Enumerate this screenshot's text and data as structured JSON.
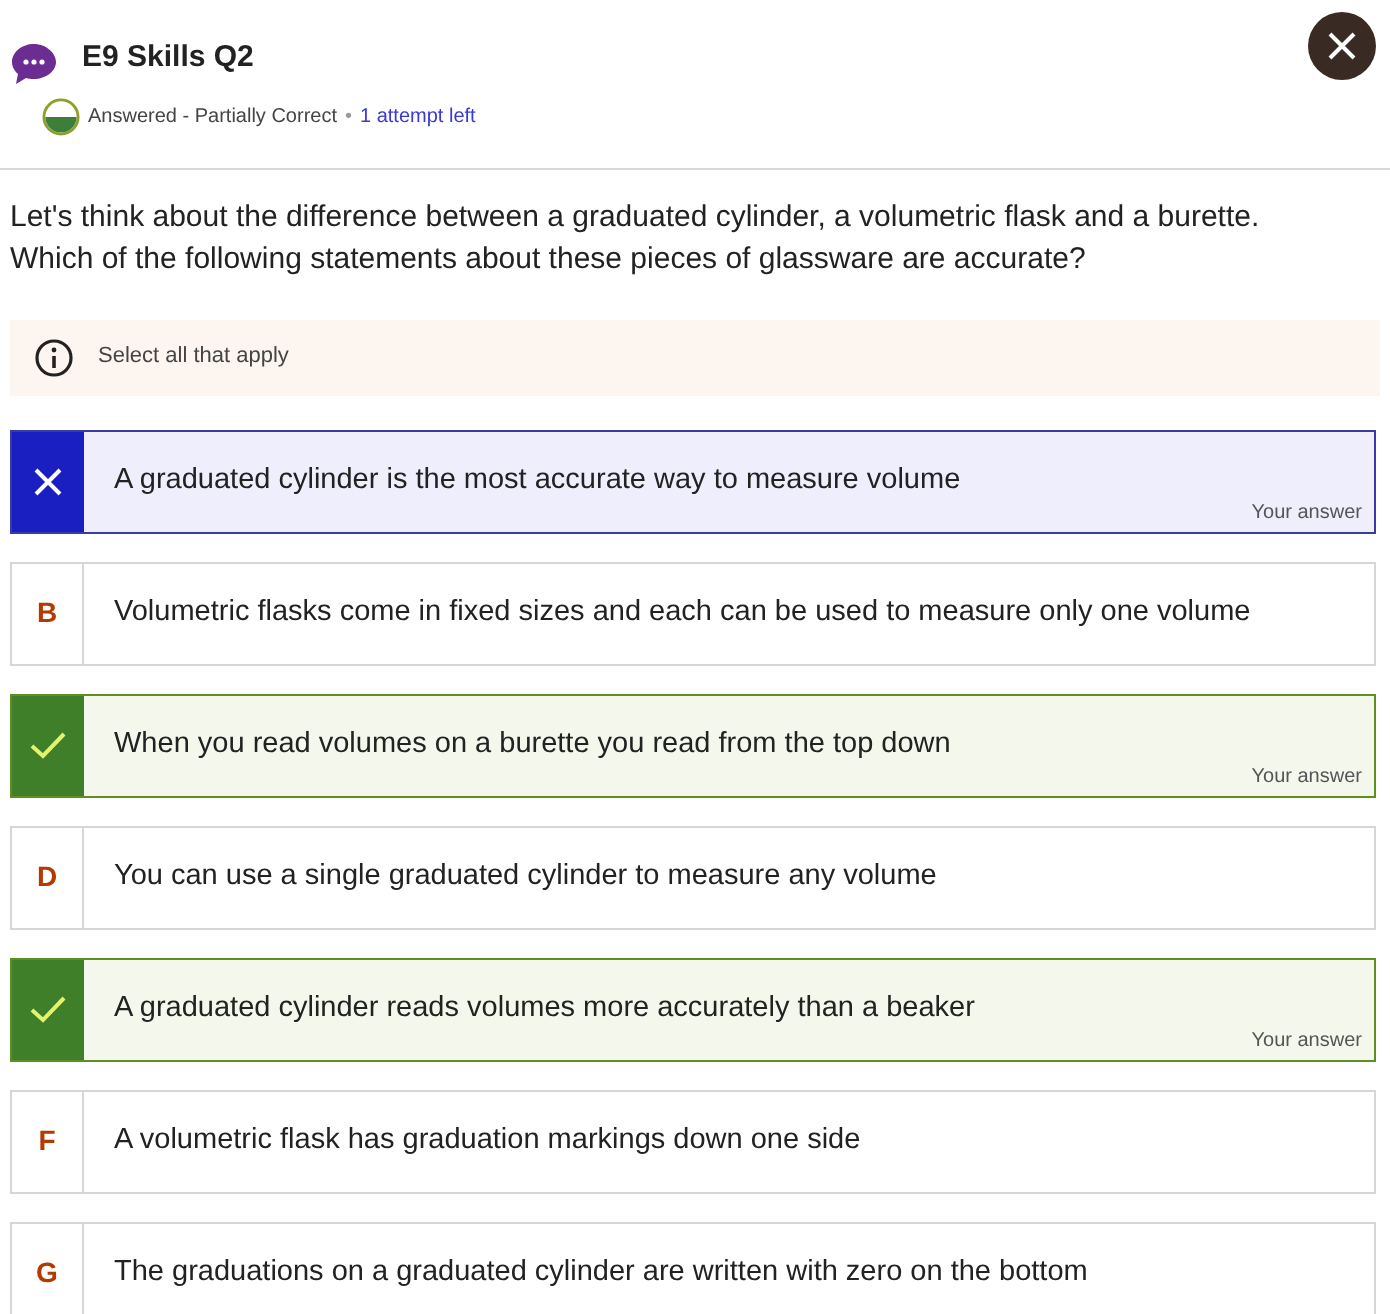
{
  "header": {
    "title": "E9 Skills Q2",
    "status": "Answered - Partially Correct",
    "separator": "•",
    "attempts": "1 attempt left"
  },
  "question": {
    "lines": [
      "Let's think about the difference between a graduated cylinder, a volumetric flask and a burette.",
      "Which of the following statements about these pieces of glassware are accurate?"
    ]
  },
  "hint": "Select all that apply",
  "options": [
    {
      "kind": "incorrect",
      "text": "A graduated cylinder is the most accurate way to measure volume",
      "tag": "Your answer"
    },
    {
      "kind": "unselected",
      "letter": "B",
      "text": "Volumetric flasks come in fixed sizes and each can be used to measure only one volume"
    },
    {
      "kind": "correct",
      "text": "When you read volumes on a burette you read from the top down",
      "tag": "Your answer"
    },
    {
      "kind": "unselected",
      "letter": "D",
      "text": "You can use a single graduated cylinder to measure any volume"
    },
    {
      "kind": "correct",
      "text": "A graduated cylinder reads volumes more accurately than a beaker",
      "tag": "Your answer"
    },
    {
      "kind": "unselected",
      "letter": "F",
      "text": "A volumetric flask has graduation markings down one side"
    },
    {
      "kind": "unselected",
      "letter": "G",
      "text": "The graduations on a graduated cylinder are written with zero on the bottom"
    }
  ]
}
